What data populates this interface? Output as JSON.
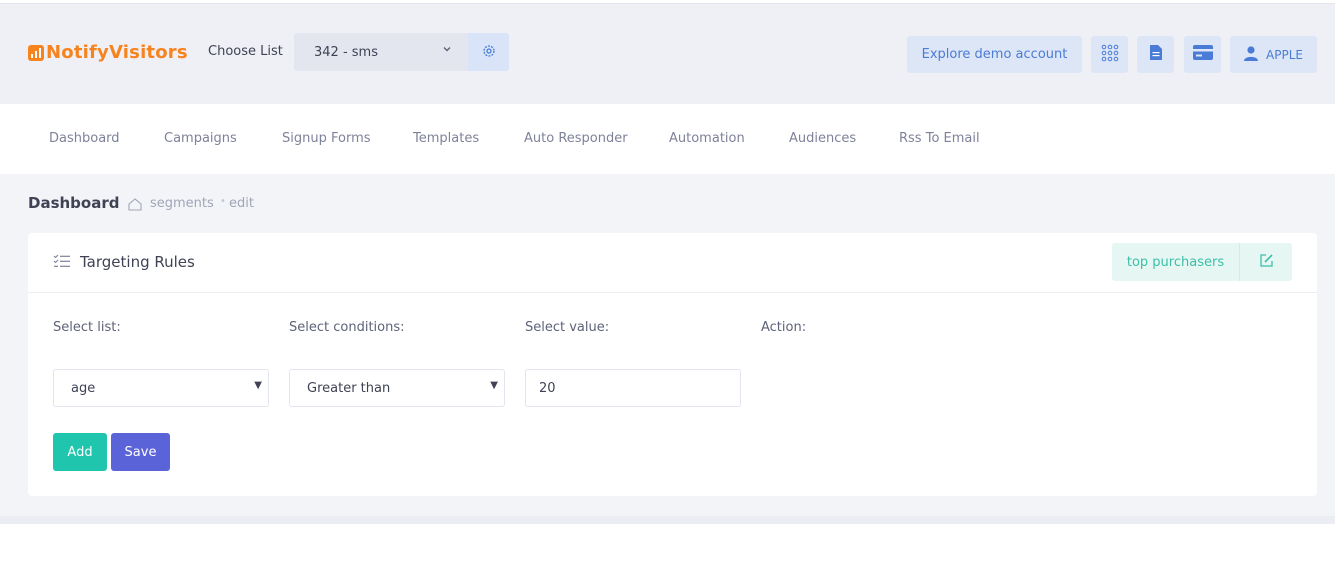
{
  "header": {
    "logo_text": "NotifyVisitors",
    "choose_list_label": "Choose List",
    "list_selected": "342 - sms",
    "demo_button": "Explore demo account",
    "user_label": "APPLE",
    "brand_color": "#f7831f",
    "accent_color": "#4a7bd6"
  },
  "nav": {
    "items": [
      "Dashboard",
      "Campaigns",
      "Signup Forms",
      "Templates",
      "Auto Responder",
      "Automation",
      "Audiences",
      "Rss To Email"
    ]
  },
  "breadcrumb": {
    "title": "Dashboard",
    "segment": "segments",
    "page": "edit"
  },
  "card": {
    "title": "Targeting Rules",
    "segment_name": "top purchasers"
  },
  "form": {
    "labels": {
      "list": "Select list:",
      "conditions": "Select conditions:",
      "value": "Select value:",
      "action": "Action:"
    },
    "list_value": "age",
    "condition_value": "Greater than",
    "input_value": "20",
    "add_button": "Add",
    "save_button": "Save",
    "add_color": "#1fc5ad",
    "save_color": "#5b63d8"
  }
}
